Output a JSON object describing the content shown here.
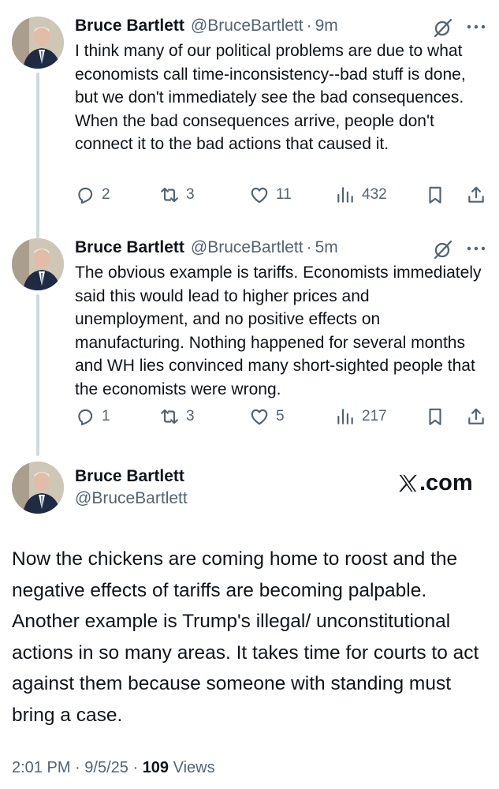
{
  "tweets": [
    {
      "name": "Bruce Bartlett",
      "handle": "@BruceBartlett",
      "time": "9m",
      "text": "I think many of our political problems are due to what economists call time-inconsistency--bad stuff is done, but we don't immediately see the bad consequences. When the bad consequences arrive, people don't connect it to the bad actions that caused it.",
      "replies": "2",
      "reposts": "3",
      "likes": "11",
      "views": "432"
    },
    {
      "name": "Bruce Bartlett",
      "handle": "@BruceBartlett",
      "time": "5m",
      "text": "The obvious example is tariffs. Economists immediately said this would lead to higher prices and unemployment, and no positive effects on manufacturing. Nothing happened for several months and WH lies convinced many short-sighted people that the economists were wrong.",
      "replies": "1",
      "reposts": "3",
      "likes": "5",
      "views": "217"
    }
  ],
  "separator": "·",
  "main_post": {
    "name": "Bruce Bartlett",
    "handle": "@BruceBartlett",
    "brand": ".com",
    "text": "Now the chickens are coming home to roost and the negative effects of tariffs are becoming palpable. Another example is Trump's illegal/ unconstitutional actions in so many areas. It takes time for courts to act against them because someone with standing must bring a case.",
    "time": "2:01 PM",
    "date": "9/5/25",
    "views_count": "109",
    "views_label": "Views"
  },
  "colors": {
    "text": "#0f1419",
    "secondary": "#536471",
    "thread_line": "#cfd9de"
  },
  "icons": [
    "grok-icon",
    "more-icon",
    "reply-icon",
    "repost-icon",
    "like-icon",
    "views-icon",
    "bookmark-icon",
    "share-icon",
    "x-logo-icon"
  ]
}
